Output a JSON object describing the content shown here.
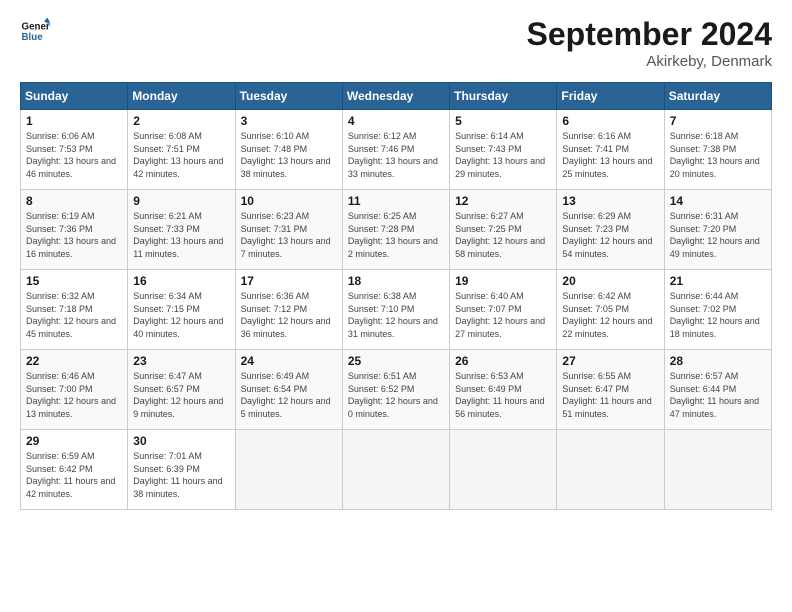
{
  "header": {
    "logo_line1": "General",
    "logo_line2": "Blue",
    "month": "September 2024",
    "location": "Akirkeby, Denmark"
  },
  "weekdays": [
    "Sunday",
    "Monday",
    "Tuesday",
    "Wednesday",
    "Thursday",
    "Friday",
    "Saturday"
  ],
  "weeks": [
    [
      {
        "day": "1",
        "sunrise": "Sunrise: 6:06 AM",
        "sunset": "Sunset: 7:53 PM",
        "daylight": "Daylight: 13 hours and 46 minutes."
      },
      {
        "day": "2",
        "sunrise": "Sunrise: 6:08 AM",
        "sunset": "Sunset: 7:51 PM",
        "daylight": "Daylight: 13 hours and 42 minutes."
      },
      {
        "day": "3",
        "sunrise": "Sunrise: 6:10 AM",
        "sunset": "Sunset: 7:48 PM",
        "daylight": "Daylight: 13 hours and 38 minutes."
      },
      {
        "day": "4",
        "sunrise": "Sunrise: 6:12 AM",
        "sunset": "Sunset: 7:46 PM",
        "daylight": "Daylight: 13 hours and 33 minutes."
      },
      {
        "day": "5",
        "sunrise": "Sunrise: 6:14 AM",
        "sunset": "Sunset: 7:43 PM",
        "daylight": "Daylight: 13 hours and 29 minutes."
      },
      {
        "day": "6",
        "sunrise": "Sunrise: 6:16 AM",
        "sunset": "Sunset: 7:41 PM",
        "daylight": "Daylight: 13 hours and 25 minutes."
      },
      {
        "day": "7",
        "sunrise": "Sunrise: 6:18 AM",
        "sunset": "Sunset: 7:38 PM",
        "daylight": "Daylight: 13 hours and 20 minutes."
      }
    ],
    [
      {
        "day": "8",
        "sunrise": "Sunrise: 6:19 AM",
        "sunset": "Sunset: 7:36 PM",
        "daylight": "Daylight: 13 hours and 16 minutes."
      },
      {
        "day": "9",
        "sunrise": "Sunrise: 6:21 AM",
        "sunset": "Sunset: 7:33 PM",
        "daylight": "Daylight: 13 hours and 11 minutes."
      },
      {
        "day": "10",
        "sunrise": "Sunrise: 6:23 AM",
        "sunset": "Sunset: 7:31 PM",
        "daylight": "Daylight: 13 hours and 7 minutes."
      },
      {
        "day": "11",
        "sunrise": "Sunrise: 6:25 AM",
        "sunset": "Sunset: 7:28 PM",
        "daylight": "Daylight: 13 hours and 2 minutes."
      },
      {
        "day": "12",
        "sunrise": "Sunrise: 6:27 AM",
        "sunset": "Sunset: 7:25 PM",
        "daylight": "Daylight: 12 hours and 58 minutes."
      },
      {
        "day": "13",
        "sunrise": "Sunrise: 6:29 AM",
        "sunset": "Sunset: 7:23 PM",
        "daylight": "Daylight: 12 hours and 54 minutes."
      },
      {
        "day": "14",
        "sunrise": "Sunrise: 6:31 AM",
        "sunset": "Sunset: 7:20 PM",
        "daylight": "Daylight: 12 hours and 49 minutes."
      }
    ],
    [
      {
        "day": "15",
        "sunrise": "Sunrise: 6:32 AM",
        "sunset": "Sunset: 7:18 PM",
        "daylight": "Daylight: 12 hours and 45 minutes."
      },
      {
        "day": "16",
        "sunrise": "Sunrise: 6:34 AM",
        "sunset": "Sunset: 7:15 PM",
        "daylight": "Daylight: 12 hours and 40 minutes."
      },
      {
        "day": "17",
        "sunrise": "Sunrise: 6:36 AM",
        "sunset": "Sunset: 7:12 PM",
        "daylight": "Daylight: 12 hours and 36 minutes."
      },
      {
        "day": "18",
        "sunrise": "Sunrise: 6:38 AM",
        "sunset": "Sunset: 7:10 PM",
        "daylight": "Daylight: 12 hours and 31 minutes."
      },
      {
        "day": "19",
        "sunrise": "Sunrise: 6:40 AM",
        "sunset": "Sunset: 7:07 PM",
        "daylight": "Daylight: 12 hours and 27 minutes."
      },
      {
        "day": "20",
        "sunrise": "Sunrise: 6:42 AM",
        "sunset": "Sunset: 7:05 PM",
        "daylight": "Daylight: 12 hours and 22 minutes."
      },
      {
        "day": "21",
        "sunrise": "Sunrise: 6:44 AM",
        "sunset": "Sunset: 7:02 PM",
        "daylight": "Daylight: 12 hours and 18 minutes."
      }
    ],
    [
      {
        "day": "22",
        "sunrise": "Sunrise: 6:46 AM",
        "sunset": "Sunset: 7:00 PM",
        "daylight": "Daylight: 12 hours and 13 minutes."
      },
      {
        "day": "23",
        "sunrise": "Sunrise: 6:47 AM",
        "sunset": "Sunset: 6:57 PM",
        "daylight": "Daylight: 12 hours and 9 minutes."
      },
      {
        "day": "24",
        "sunrise": "Sunrise: 6:49 AM",
        "sunset": "Sunset: 6:54 PM",
        "daylight": "Daylight: 12 hours and 5 minutes."
      },
      {
        "day": "25",
        "sunrise": "Sunrise: 6:51 AM",
        "sunset": "Sunset: 6:52 PM",
        "daylight": "Daylight: 12 hours and 0 minutes."
      },
      {
        "day": "26",
        "sunrise": "Sunrise: 6:53 AM",
        "sunset": "Sunset: 6:49 PM",
        "daylight": "Daylight: 11 hours and 56 minutes."
      },
      {
        "day": "27",
        "sunrise": "Sunrise: 6:55 AM",
        "sunset": "Sunset: 6:47 PM",
        "daylight": "Daylight: 11 hours and 51 minutes."
      },
      {
        "day": "28",
        "sunrise": "Sunrise: 6:57 AM",
        "sunset": "Sunset: 6:44 PM",
        "daylight": "Daylight: 11 hours and 47 minutes."
      }
    ],
    [
      {
        "day": "29",
        "sunrise": "Sunrise: 6:59 AM",
        "sunset": "Sunset: 6:42 PM",
        "daylight": "Daylight: 11 hours and 42 minutes."
      },
      {
        "day": "30",
        "sunrise": "Sunrise: 7:01 AM",
        "sunset": "Sunset: 6:39 PM",
        "daylight": "Daylight: 11 hours and 38 minutes."
      },
      null,
      null,
      null,
      null,
      null
    ]
  ]
}
